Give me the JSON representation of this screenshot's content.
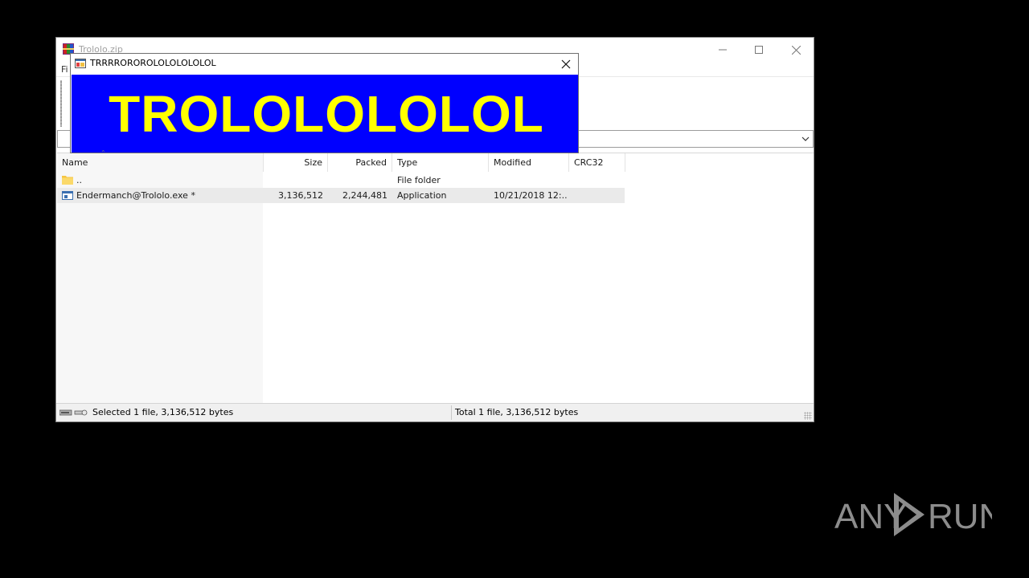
{
  "main_window": {
    "title": "Trololo.zip",
    "menu_fragment": "Fi"
  },
  "file_list": {
    "columns": [
      {
        "key": "name",
        "label": "Name"
      },
      {
        "key": "size",
        "label": "Size"
      },
      {
        "key": "packed",
        "label": "Packed"
      },
      {
        "key": "type",
        "label": "Type"
      },
      {
        "key": "modified",
        "label": "Modified"
      },
      {
        "key": "crc32",
        "label": "CRC32"
      }
    ],
    "rows": [
      {
        "name": "..",
        "size": "",
        "packed": "",
        "type": "File folder",
        "modified": "",
        "crc32": "",
        "icon": "folder-icon"
      },
      {
        "name": "Endermanch@Trololo.exe *",
        "size": "3,136,512",
        "packed": "2,244,481",
        "type": "Application",
        "modified": "10/21/2018 12:...",
        "crc32": "",
        "icon": "application-icon"
      }
    ]
  },
  "status_bar": {
    "left": "Selected 1 file, 3,136,512 bytes",
    "right": "Total 1 file, 3,136,512 bytes"
  },
  "popup": {
    "title": "TRRRROROROLOLOLOLOLOL",
    "banner_text": "TROLOLOLOLOL",
    "banner_bg": "#0000ff",
    "banner_fg": "#ffff00"
  },
  "watermark": {
    "left_text": "ANY",
    "right_text": "RUN"
  }
}
